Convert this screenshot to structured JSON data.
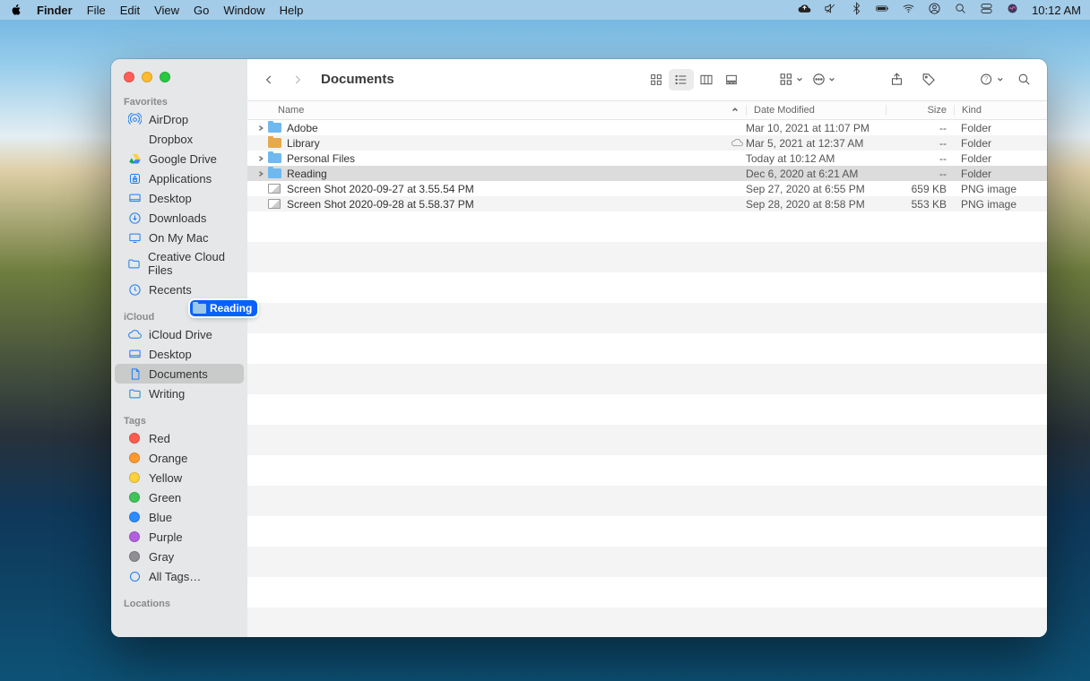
{
  "menubar": {
    "app": "Finder",
    "items": [
      "File",
      "Edit",
      "View",
      "Go",
      "Window",
      "Help"
    ],
    "clock": "10:12 AM"
  },
  "window": {
    "title": "Documents"
  },
  "sidebar": {
    "sections": {
      "favorites": "Favorites",
      "icloud": "iCloud",
      "tags": "Tags",
      "locations": "Locations"
    },
    "favorites": [
      {
        "label": "AirDrop",
        "icon": "airdrop"
      },
      {
        "label": "Dropbox",
        "icon": "dropbox"
      },
      {
        "label": "Google Drive",
        "icon": "gdrive"
      },
      {
        "label": "Applications",
        "icon": "apps"
      },
      {
        "label": "Desktop",
        "icon": "desktop"
      },
      {
        "label": "Downloads",
        "icon": "downloads"
      },
      {
        "label": "On My Mac",
        "icon": "mac"
      },
      {
        "label": "Creative Cloud Files",
        "icon": "folder"
      },
      {
        "label": "Recents",
        "icon": "clock"
      }
    ],
    "icloud": [
      {
        "label": "iCloud Drive",
        "icon": "cloud"
      },
      {
        "label": "Desktop",
        "icon": "desktop"
      },
      {
        "label": "Documents",
        "icon": "doc",
        "selected": true
      },
      {
        "label": "Writing",
        "icon": "folder"
      }
    ],
    "tags": [
      {
        "label": "Red",
        "color": "#ff5b4f"
      },
      {
        "label": "Orange",
        "color": "#ff9a2f"
      },
      {
        "label": "Yellow",
        "color": "#ffd23c"
      },
      {
        "label": "Green",
        "color": "#3fc45a"
      },
      {
        "label": "Blue",
        "color": "#2c8cff"
      },
      {
        "label": "Purple",
        "color": "#b25fe0"
      },
      {
        "label": "Gray",
        "color": "#8e8e93"
      }
    ],
    "all_tags_label": "All Tags…"
  },
  "columns": {
    "name": "Name",
    "date": "Date Modified",
    "size": "Size",
    "kind": "Kind"
  },
  "files": [
    {
      "name": "Adobe",
      "date": "Mar 10, 2021 at 11:07 PM",
      "size": "--",
      "kind": "Folder",
      "icon": "folder",
      "expandable": true
    },
    {
      "name": "Library",
      "date": "Mar 5, 2021 at 12:37 AM",
      "size": "--",
      "kind": "Folder",
      "icon": "folder-gold",
      "cloud": true
    },
    {
      "name": "Personal Files",
      "date": "Today at 10:12 AM",
      "size": "--",
      "kind": "Folder",
      "icon": "folder",
      "expandable": true
    },
    {
      "name": "Reading",
      "date": "Dec 6, 2020 at 6:21 AM",
      "size": "--",
      "kind": "Folder",
      "icon": "folder",
      "expandable": true,
      "selected": true
    },
    {
      "name": "Screen Shot 2020-09-27 at 3.55.54 PM",
      "date": "Sep 27, 2020 at 6:55 PM",
      "size": "659 KB",
      "kind": "PNG image",
      "icon": "image"
    },
    {
      "name": "Screen Shot 2020-09-28 at 5.58.37 PM",
      "date": "Sep 28, 2020 at 8:58 PM",
      "size": "553 KB",
      "kind": "PNG image",
      "icon": "image"
    }
  ],
  "drag": {
    "label": "Reading"
  },
  "colors": {
    "accent": "#0a60ff"
  }
}
